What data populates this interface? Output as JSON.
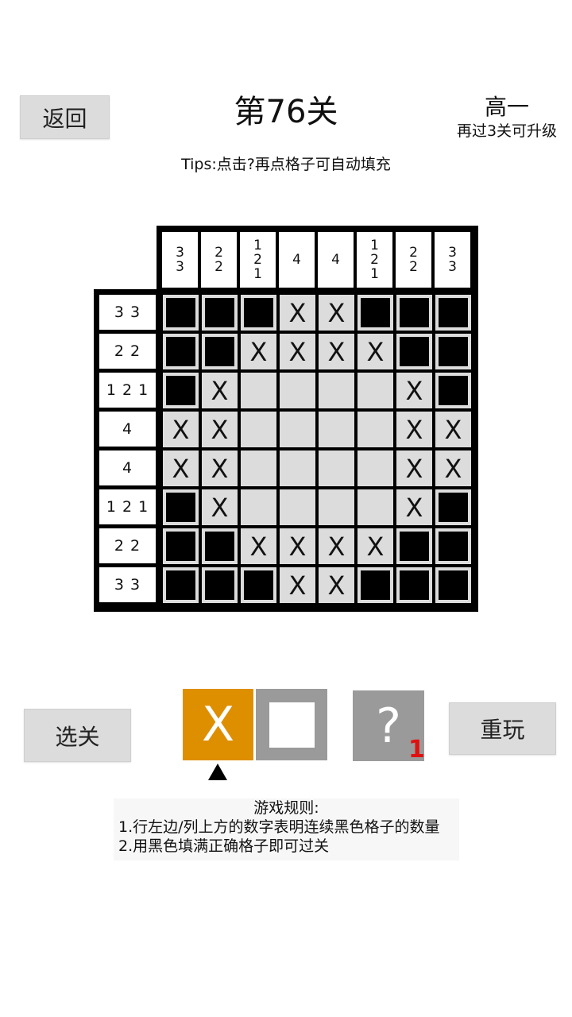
{
  "header": {
    "back_label": "返回",
    "title": "第76关",
    "grade": "高一",
    "grade_note": "再过3关可升级",
    "tips": "Tips:点击?再点格子可自动填充"
  },
  "board": {
    "col_clues": [
      "3\n3",
      "2\n2",
      "1\n2\n1",
      "4",
      "4",
      "1\n2\n1",
      "2\n2",
      "3\n3"
    ],
    "row_clues": [
      "3 3",
      "2 2",
      "1 2 1",
      "4",
      "4",
      "1 2 1",
      "2 2",
      "3 3"
    ],
    "cells": [
      [
        "filled",
        "filled",
        "filled",
        "X",
        "X",
        "filled",
        "filled",
        "filled"
      ],
      [
        "filled",
        "filled",
        "X",
        "X",
        "X",
        "X",
        "filled",
        "filled"
      ],
      [
        "filled",
        "X",
        "",
        "",
        "",
        "",
        "X",
        "filled"
      ],
      [
        "X",
        "X",
        "",
        "",
        "",
        "",
        "X",
        "X"
      ],
      [
        "X",
        "X",
        "",
        "",
        "",
        "",
        "X",
        "X"
      ],
      [
        "filled",
        "X",
        "",
        "",
        "",
        "",
        "X",
        "filled"
      ],
      [
        "filled",
        "filled",
        "X",
        "X",
        "X",
        "X",
        "filled",
        "filled"
      ],
      [
        "filled",
        "filled",
        "filled",
        "X",
        "X",
        "filled",
        "filled",
        "filled"
      ]
    ]
  },
  "controls": {
    "select_level_label": "选关",
    "mode_x_label": "X",
    "hint_label": "?",
    "hint_count": "1",
    "replay_label": "重玩",
    "active_mode": "X",
    "accent_color": "#de8f00"
  },
  "rules": {
    "title": "游戏规则:",
    "line1": "1.行左边/列上方的数字表明连续黑色格子的数量",
    "line2": "2.用黑色填满正确格子即可过关"
  }
}
